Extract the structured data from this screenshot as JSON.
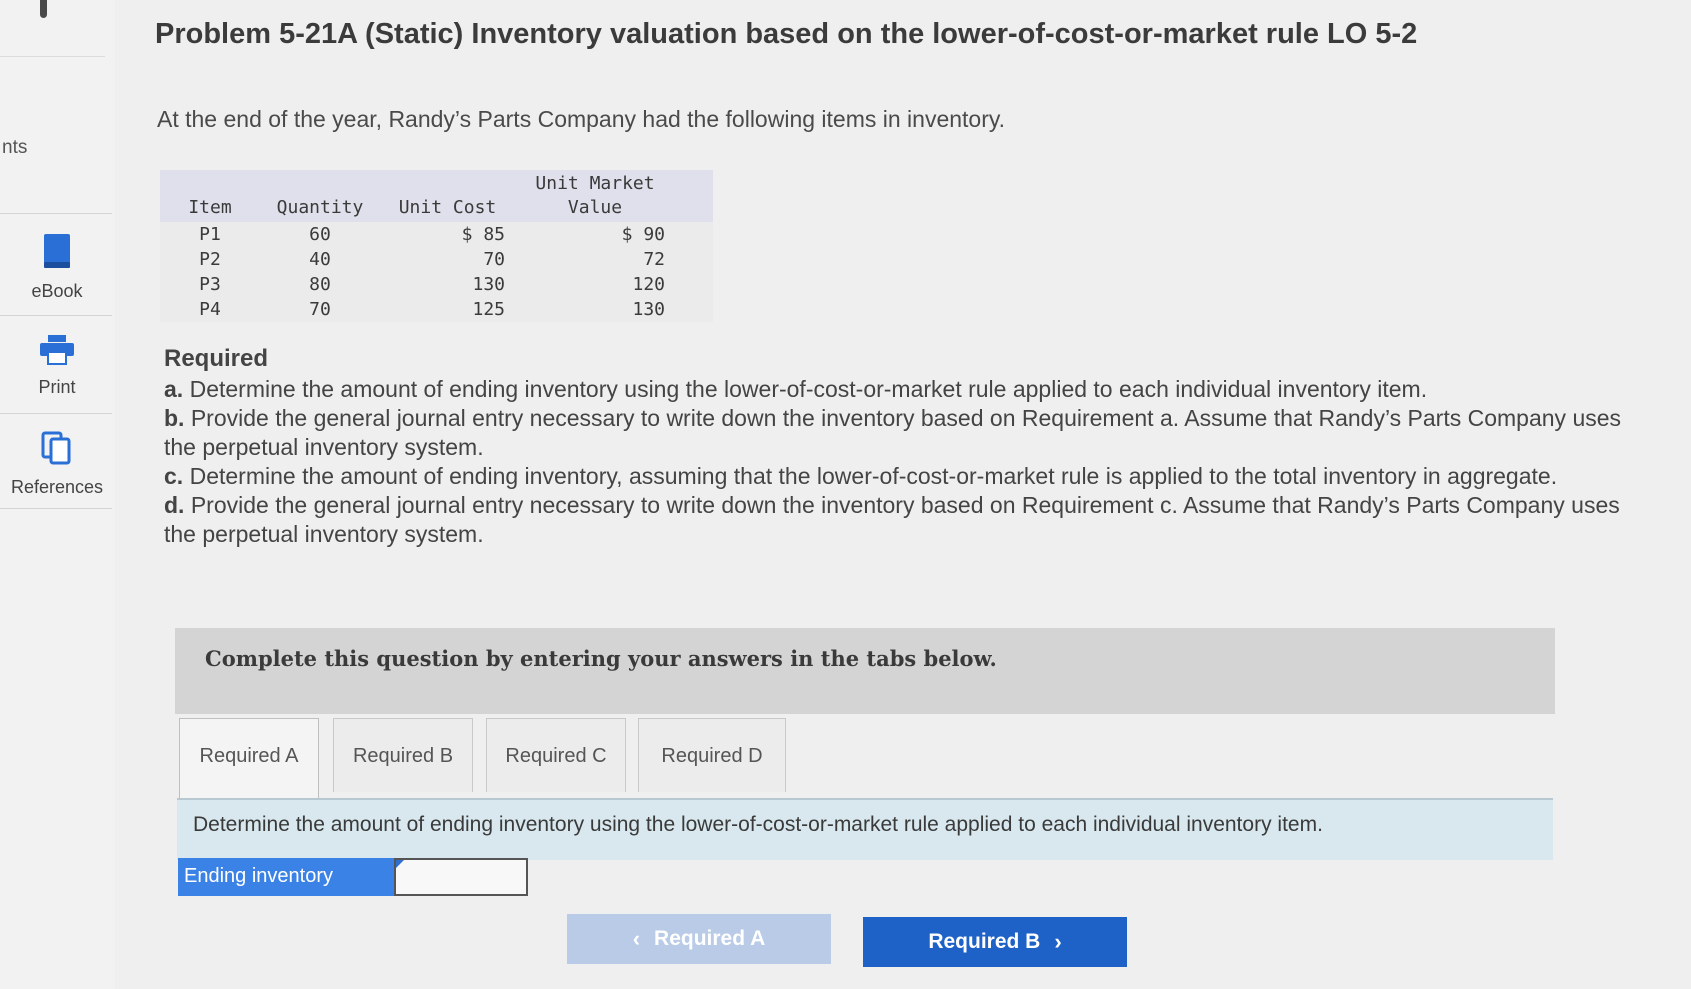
{
  "sidebar": {
    "partial_label": "nts",
    "items": [
      {
        "label": "eBook",
        "icon": "book-icon"
      },
      {
        "label": "Print",
        "icon": "printer-icon"
      },
      {
        "label": "References",
        "icon": "copy-pages-icon"
      }
    ]
  },
  "title": "Problem 5-21A (Static) Inventory valuation based on the lower-of-cost-or-market rule LO 5-2",
  "intro": "At the end of the year, Randy’s Parts Company had the following items in inventory.",
  "inventory_table": {
    "headers": {
      "item": "Item",
      "quantity": "Quantity",
      "unit_cost": "Unit Cost",
      "unit_market_line1": "Unit Market",
      "unit_market_line2": "Value"
    },
    "rows": [
      {
        "item": "P1",
        "quantity": "60",
        "unit_cost": "$ 85",
        "unit_market": "$ 90"
      },
      {
        "item": "P2",
        "quantity": "40",
        "unit_cost": "70",
        "unit_market": "72"
      },
      {
        "item": "P3",
        "quantity": "80",
        "unit_cost": "130",
        "unit_market": "120"
      },
      {
        "item": "P4",
        "quantity": "70",
        "unit_cost": "125",
        "unit_market": "130"
      }
    ]
  },
  "required": {
    "heading": "Required",
    "items": [
      {
        "letter": "a.",
        "text": "Determine the amount of ending inventory using the lower-of-cost-or-market rule applied to each individual inventory item."
      },
      {
        "letter": "b.",
        "text": "Provide the general journal entry necessary to write down the inventory based on Requirement a. Assume that Randy’s Parts Company uses the perpetual inventory system."
      },
      {
        "letter": "c.",
        "text": "Determine the amount of ending inventory, assuming that the lower-of-cost-or-market rule is applied to the total inventory in aggregate."
      },
      {
        "letter": "d.",
        "text": "Provide the general journal entry necessary to write down the inventory based on Requirement c. Assume that Randy’s Parts Company uses the perpetual inventory system."
      }
    ]
  },
  "banner": "Complete this question by entering your answers in the tabs below.",
  "tabs": [
    {
      "label": "Required A"
    },
    {
      "label": "Required B"
    },
    {
      "label": "Required C"
    },
    {
      "label": "Required D"
    }
  ],
  "tab_content": "Determine the amount of ending inventory using the lower-of-cost-or-market rule applied to each individual inventory item.",
  "answer": {
    "label": "Ending inventory",
    "value": ""
  },
  "nav": {
    "prev_label": "Required A",
    "next_label": "Required B"
  },
  "colors": {
    "accent": "#1f62c7",
    "accent_disabled": "#b9cbe6",
    "answer_label_bg": "#3b82e6",
    "content_bar_bg": "#d8e8ee"
  }
}
